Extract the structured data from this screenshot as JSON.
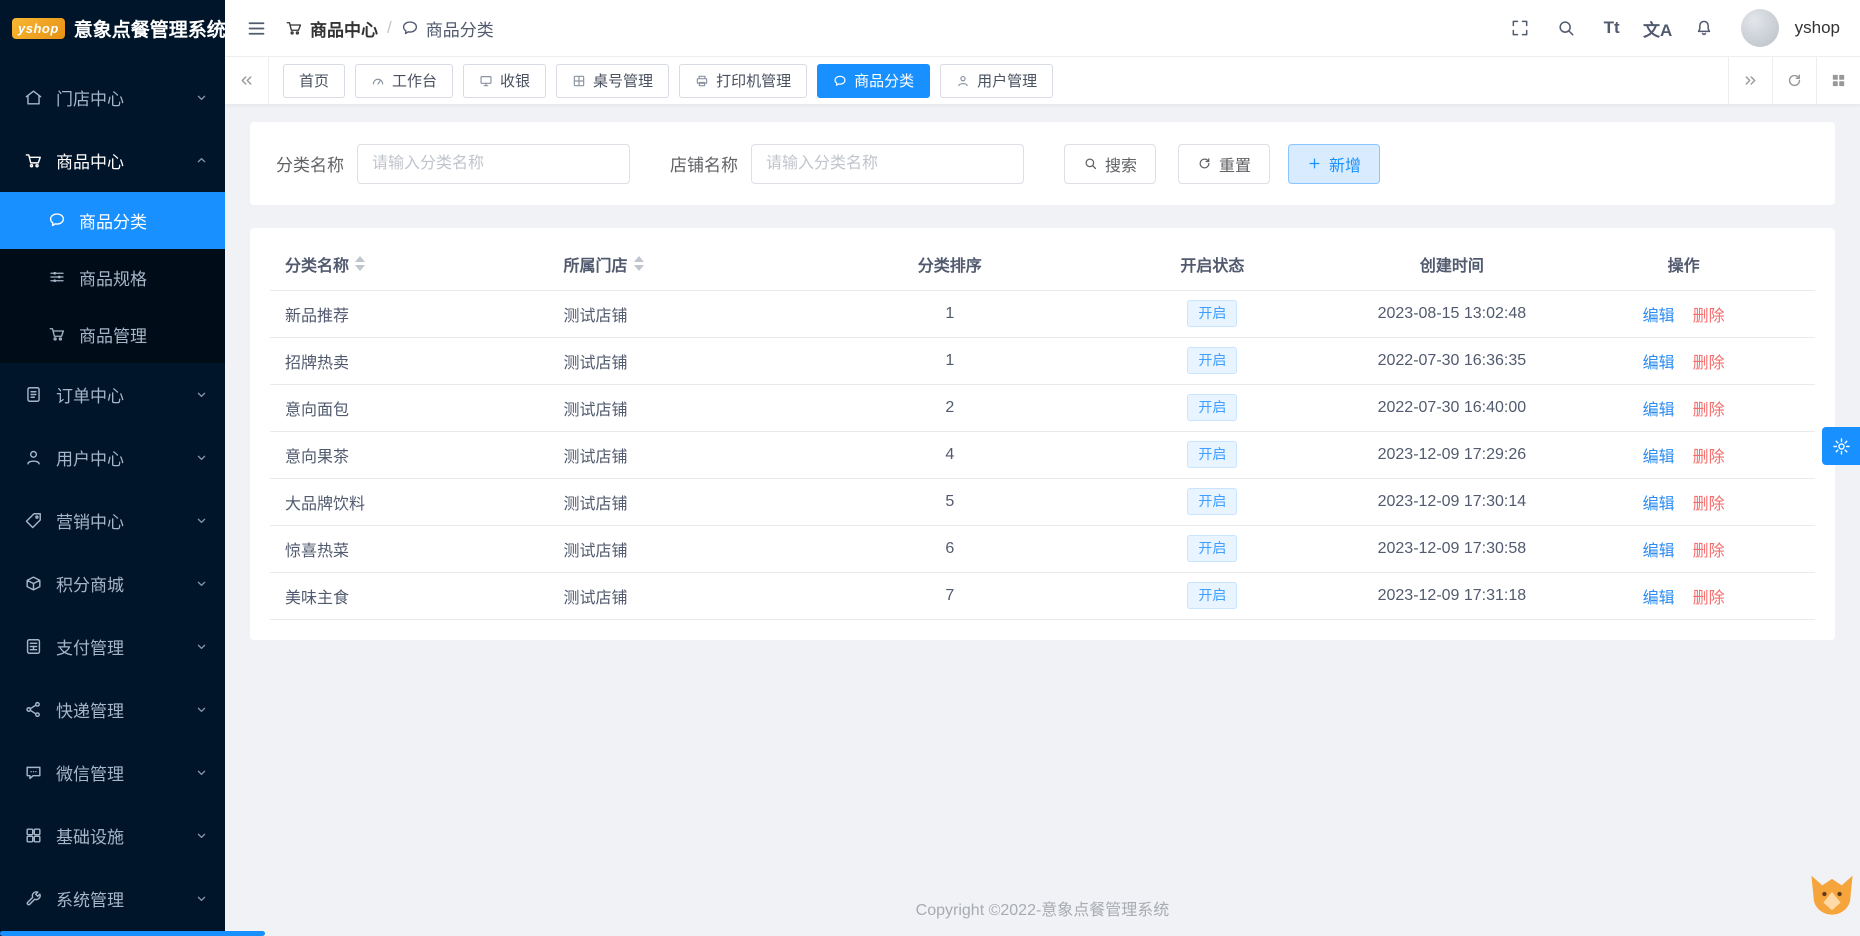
{
  "app": {
    "logo_text": "yshop",
    "title": "意象点餐管理系统"
  },
  "header": {
    "breadcrumb": [
      "商品中心",
      "商品分类"
    ],
    "breadcrumb_separator": "/",
    "font_size_glyph": "Tt",
    "translate_glyph": "文A",
    "username": "yshop",
    "action_icons": [
      "fullscreen-icon",
      "search-icon",
      "font-size-icon",
      "translate-icon",
      "bell-icon"
    ]
  },
  "sidebar": {
    "items": [
      {
        "label": "门店中心",
        "icon": "home-icon"
      },
      {
        "label": "商品中心",
        "icon": "cart-icon",
        "expanded": true,
        "children": [
          {
            "label": "商品分类",
            "icon": "comment-icon",
            "active": true
          },
          {
            "label": "商品规格",
            "icon": "sliders-icon"
          },
          {
            "label": "商品管理",
            "icon": "cart-icon"
          }
        ]
      },
      {
        "label": "订单中心",
        "icon": "order-icon"
      },
      {
        "label": "用户中心",
        "icon": "user-icon"
      },
      {
        "label": "营销中心",
        "icon": "tag-icon"
      },
      {
        "label": "积分商城",
        "icon": "box-icon"
      },
      {
        "label": "支付管理",
        "icon": "calculator-icon"
      },
      {
        "label": "快递管理",
        "icon": "share-icon"
      },
      {
        "label": "微信管理",
        "icon": "wechat-icon"
      },
      {
        "label": "基础设施",
        "icon": "apps-icon"
      },
      {
        "label": "系统管理",
        "icon": "wrench-icon"
      }
    ]
  },
  "tabs": {
    "items": [
      {
        "label": "首页"
      },
      {
        "label": "工作台",
        "icon": "dashboard-icon"
      },
      {
        "label": "收银",
        "icon": "monitor-icon"
      },
      {
        "label": "桌号管理",
        "icon": "table-grid-icon"
      },
      {
        "label": "打印机管理",
        "icon": "printer-icon"
      },
      {
        "label": "商品分类",
        "icon": "comment-icon",
        "active": true
      },
      {
        "label": "用户管理",
        "icon": "user-icon"
      }
    ]
  },
  "filters": {
    "category_label": "分类名称",
    "category_placeholder": "请输入分类名称",
    "category_value": "",
    "store_label": "店铺名称",
    "store_placeholder": "请输入分类名称",
    "store_value": "",
    "search_label": "搜索",
    "reset_label": "重置",
    "add_label": "新增"
  },
  "table": {
    "headers": [
      "分类名称",
      "所属门店",
      "分类排序",
      "开启状态",
      "创建时间",
      "操作"
    ],
    "sortable_columns": [
      "分类名称",
      "所属门店"
    ],
    "edit_label": "编辑",
    "delete_label": "删除",
    "rows": [
      {
        "name": "新品推荐",
        "store": "测试店铺",
        "sort": "1",
        "status": "开启",
        "created": "2023-08-15 13:02:48"
      },
      {
        "name": "招牌热卖",
        "store": "测试店铺",
        "sort": "1",
        "status": "开启",
        "created": "2022-07-30 16:36:35"
      },
      {
        "name": "意向面包",
        "store": "测试店铺",
        "sort": "2",
        "status": "开启",
        "created": "2022-07-30 16:40:00"
      },
      {
        "name": "意向果茶",
        "store": "测试店铺",
        "sort": "4",
        "status": "开启",
        "created": "2023-12-09 17:29:26"
      },
      {
        "name": "大品牌饮料",
        "store": "测试店铺",
        "sort": "5",
        "status": "开启",
        "created": "2023-12-09 17:30:14"
      },
      {
        "name": "惊喜热菜",
        "store": "测试店铺",
        "sort": "6",
        "status": "开启",
        "created": "2023-12-09 17:30:58"
      },
      {
        "name": "美味主食",
        "store": "测试店铺",
        "sort": "7",
        "status": "开启",
        "created": "2023-12-09 17:31:18"
      }
    ]
  },
  "footer": {
    "copyright": "Copyright ©2022-意象点餐管理系统"
  },
  "colors": {
    "primary": "#1890ff",
    "element_blue": "#409eff",
    "sidebar_bg": "#001529",
    "submenu_bg": "#000c17",
    "danger": "#f56c6c",
    "content_bg": "#f0f2f5",
    "status_tag_bg": "#e8f4ff"
  }
}
